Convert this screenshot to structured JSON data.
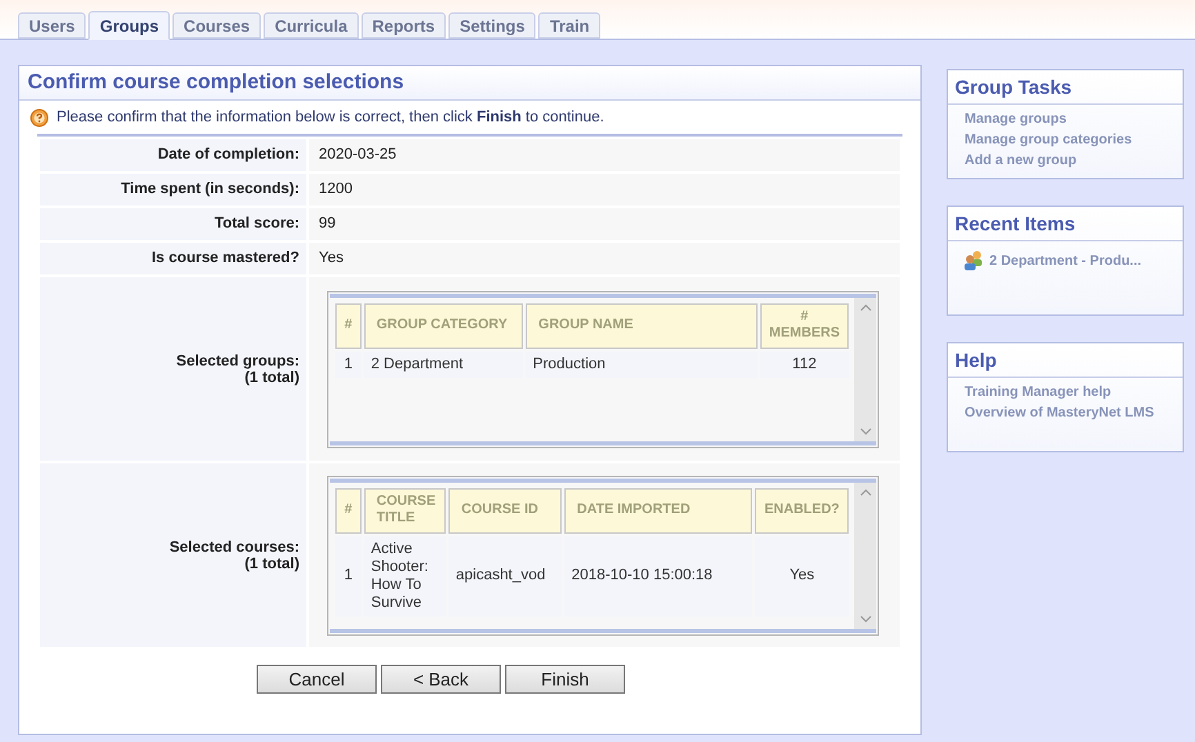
{
  "tabs": [
    {
      "label": "Users",
      "selected": false
    },
    {
      "label": "Groups",
      "selected": true
    },
    {
      "label": "Courses",
      "selected": false
    },
    {
      "label": "Curricula",
      "selected": false
    },
    {
      "label": "Reports",
      "selected": false
    },
    {
      "label": "Settings",
      "selected": false
    },
    {
      "label": "Train",
      "selected": false
    }
  ],
  "main": {
    "title": "Confirm course completion selections",
    "instruction": "Please confirm that the information below is correct, then click **Finish** to continue.",
    "fields": [
      {
        "label": "Date of completion:",
        "value": "2020-03-25"
      },
      {
        "label": "Time spent (in seconds):",
        "value": "1200"
      },
      {
        "label": "Total score:",
        "value": "99"
      },
      {
        "label": "Is course mastered?",
        "value": "Yes"
      }
    ],
    "groups": {
      "label": "Selected groups:",
      "total": "(1 total)",
      "columns": [
        "#",
        "GROUP CATEGORY",
        "GROUP NAME",
        "# MEMBERS"
      ],
      "rows": [
        [
          "1",
          "2 Department",
          "Production",
          "112"
        ]
      ]
    },
    "courses": {
      "label": "Selected courses:",
      "total": "(1 total)",
      "columns": [
        "#",
        "COURSE TITLE",
        "COURSE ID",
        "DATE IMPORTED",
        "ENABLED?"
      ],
      "rows": [
        [
          "1",
          "Active Shooter: How To Survive",
          "apicasht_vod",
          "2018-10-10 15:00:18",
          "Yes"
        ]
      ]
    },
    "buttons": [
      "Cancel",
      "< Back",
      "Finish"
    ]
  },
  "sidebar": [
    {
      "title": "Group Tasks",
      "items": [
        {
          "kind": "link",
          "label": "Manage groups"
        },
        {
          "kind": "link",
          "label": "Manage group categories"
        },
        {
          "kind": "link",
          "label": "Add a new group"
        }
      ]
    },
    {
      "title": "Recent Items",
      "items": [
        {
          "kind": "group",
          "label": "2 Department - Produ..."
        }
      ]
    },
    {
      "title": "Help",
      "items": [
        {
          "kind": "link",
          "label": "Training Manager help"
        },
        {
          "kind": "link",
          "label": "Overview of MasteryNet LMS"
        }
      ]
    }
  ]
}
